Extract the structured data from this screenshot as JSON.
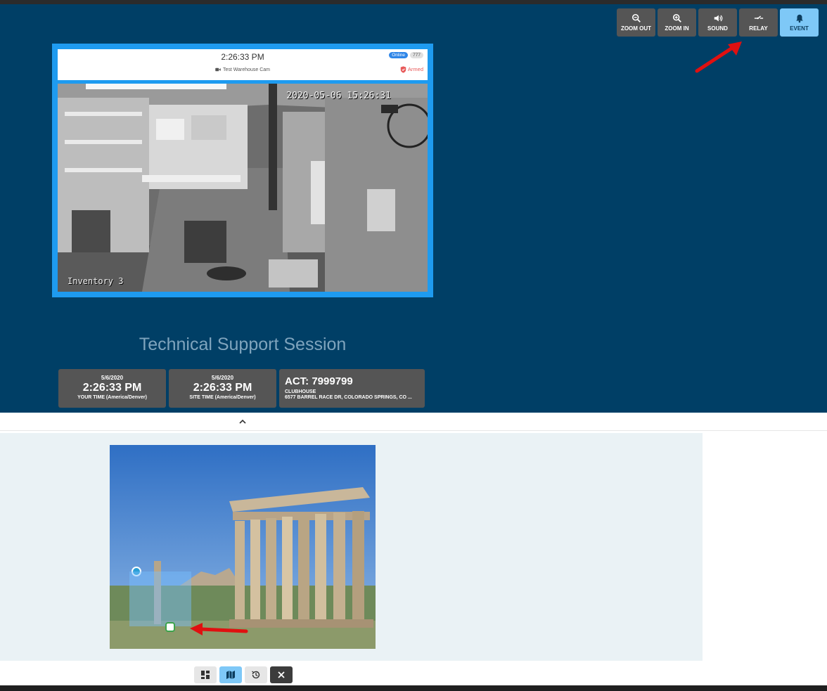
{
  "toolbar": {
    "buttons": [
      {
        "label": "ZOOM OUT",
        "icon": "zoom-out-icon"
      },
      {
        "label": "ZOOM IN",
        "icon": "zoom-in-icon"
      },
      {
        "label": "SOUND",
        "icon": "sound-icon"
      },
      {
        "label": "RELAY",
        "icon": "relay-icon"
      },
      {
        "label": "EVENT",
        "icon": "bell-icon",
        "active": true
      }
    ]
  },
  "camera": {
    "time": "2:26:33 PM",
    "name": "Test Warehouse Cam",
    "status_badge": "Online",
    "id_badge": "777",
    "armed_label": "Armed",
    "osd_timestamp": "2020-05-06 15:26:31",
    "osd_label": "Inventory 3"
  },
  "session": {
    "title": "Technical Support Session"
  },
  "your_time": {
    "date": "5/6/2020",
    "time": "2:26:33 PM",
    "label": "YOUR TIME (America/Denver)"
  },
  "site_time": {
    "date": "5/6/2020",
    "time": "2:26:33 PM",
    "label": "SITE TIME (America/Denver)"
  },
  "account": {
    "number": "ACT: 7999799",
    "name": "CLUBHOUSE",
    "address": "6577 BARREL RACE DR, COLORADO SPRINGS, CO ..."
  },
  "colors": {
    "main_bg": "#003f66",
    "button_bg": "#555555",
    "active_button": "#7ec8f7",
    "camera_border": "#1e9bf0",
    "armed": "#e85a5a",
    "annotation_arrow": "#e01010"
  },
  "bottom_bar": {
    "buttons": [
      {
        "icon": "grid-icon"
      },
      {
        "icon": "map-icon",
        "active": true
      },
      {
        "icon": "history-icon"
      },
      {
        "icon": "close-icon"
      }
    ]
  }
}
